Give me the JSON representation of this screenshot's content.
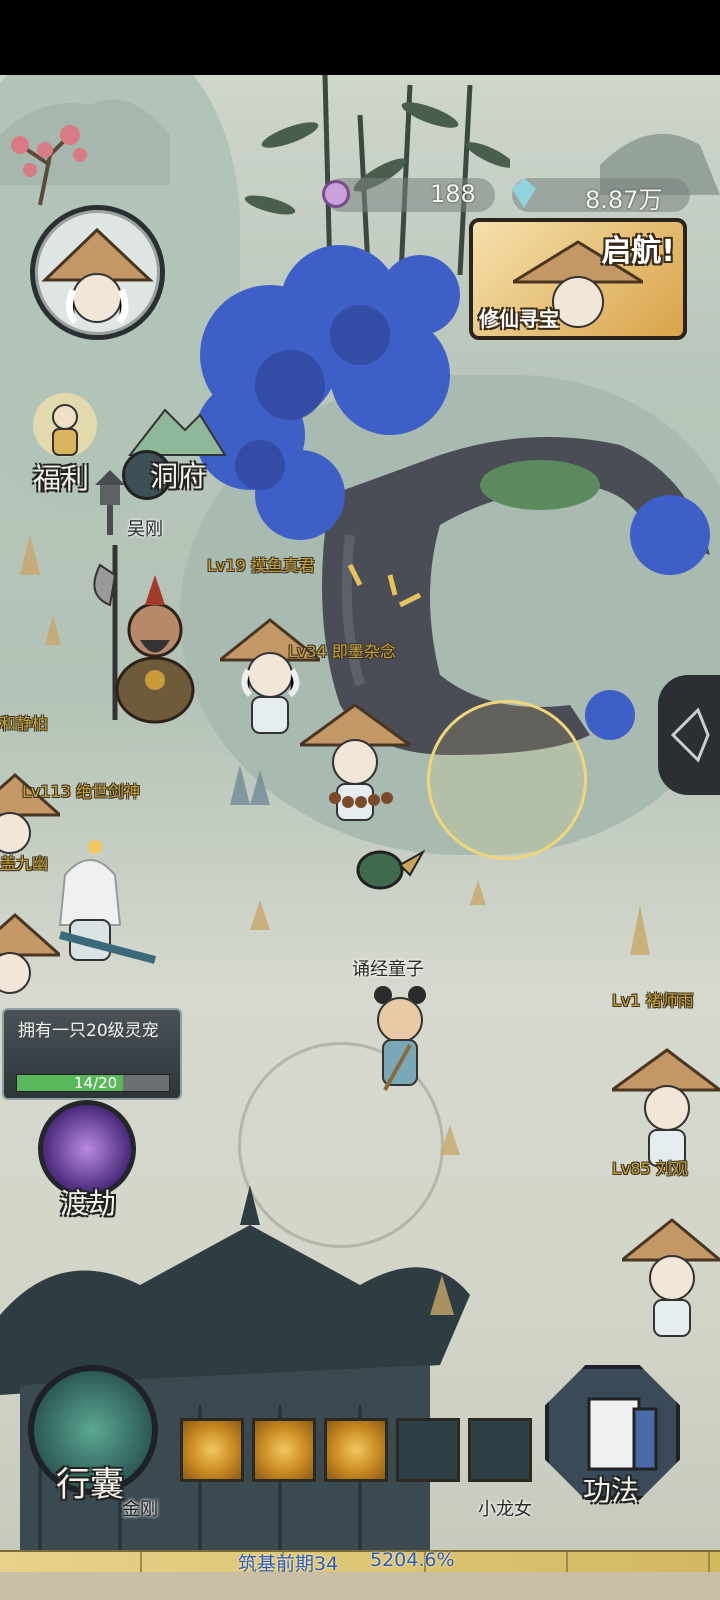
{
  "resources": {
    "spirit_count": "188",
    "crystal_count": "8.87万"
  },
  "event_banner": {
    "title": "启航!",
    "subtitle": "修仙寻宝"
  },
  "left_menu": {
    "welfare": "福利",
    "cave": "洞府",
    "tribulation": "渡劫"
  },
  "quest": {
    "text": "拥有一只20级灵宠",
    "progress_text": "14/20",
    "progress_fraction": 0.7
  },
  "characters": {
    "wu_gang": "吴刚",
    "chanting_boy": "诵经童子",
    "little_dragon_girl": "小龙女",
    "jingang": "金刚",
    "peace_partial": "和静柏",
    "gai_partial": "盖九幽"
  },
  "players": [
    {
      "level_name": "Lv19 摸鱼真君"
    },
    {
      "level_name": "Lv34 即墨杂念"
    },
    {
      "level_name": "Lv113 绝世剑神"
    },
    {
      "level_name": "Lv1 褚师雨"
    },
    {
      "level_name": "Lv85 刘观"
    }
  ],
  "bottom_bar": {
    "bag": "行囊",
    "skills": "功法",
    "cultivation": "筑基前期34",
    "exp_percent": "5204.6%"
  },
  "colors": {
    "gold": "#c7a33a",
    "progress_green": "#58b85a",
    "tree_blue": "#3f5fc8"
  }
}
